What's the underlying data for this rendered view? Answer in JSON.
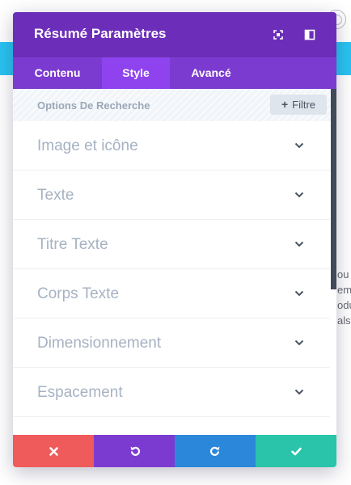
{
  "background": {
    "side_text": "ou\nem\nodu\nals"
  },
  "modal": {
    "title": "Résumé Paramètres",
    "tabs": [
      {
        "label": "Contenu",
        "active": false
      },
      {
        "label": "Style",
        "active": true
      },
      {
        "label": "Avancé",
        "active": false
      }
    ],
    "search_options_label": "Options De Recherche",
    "filter_button_label": "Filtre",
    "sections": [
      {
        "label": "Image et icône"
      },
      {
        "label": "Texte"
      },
      {
        "label": "Titre Texte"
      },
      {
        "label": "Corps Texte"
      },
      {
        "label": "Dimensionnement"
      },
      {
        "label": "Espacement"
      }
    ],
    "footer_buttons": [
      {
        "icon": "close-icon"
      },
      {
        "icon": "undo-icon"
      },
      {
        "icon": "redo-icon"
      },
      {
        "icon": "check-icon"
      }
    ]
  },
  "colors": {
    "header": "#6c2eb9",
    "tabs": "#7c3bd0",
    "active_tab": "#8f43ee",
    "discard": "#ef5a5a",
    "undo": "#7c3bd0",
    "redo": "#2b87da",
    "save": "#29c4a9",
    "page_accent": "#29c4f1"
  }
}
